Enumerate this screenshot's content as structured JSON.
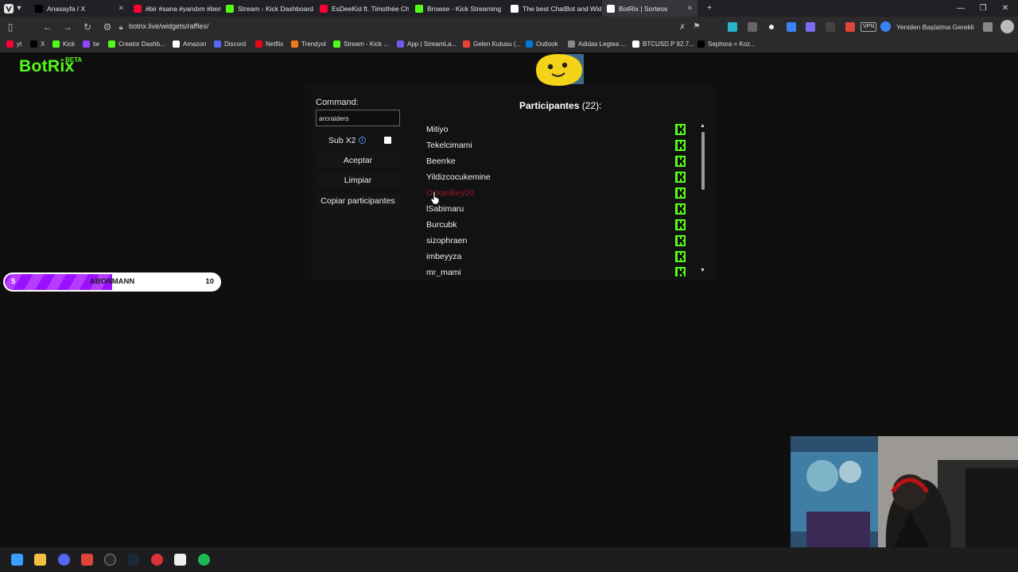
{
  "browser": {
    "tabs": [
      {
        "title": "Anasayfa / X",
        "color": "#000000"
      },
      {
        "title": "#bir #sana #yandım #ben #",
        "color": "#ff0033"
      },
      {
        "title": "Stream - Kick Dashboard",
        "color": "#53fc18"
      },
      {
        "title": "EsDeeKid ft. Timothée Chal",
        "color": "#ff0033"
      },
      {
        "title": "Browse - Kick Streaming",
        "color": "#53fc18"
      },
      {
        "title": "The best ChatBot and Widg",
        "color": "#ffffff"
      },
      {
        "title": "BotRix | Sorteos",
        "color": "#ffffff"
      }
    ],
    "url": "botrix.live/widgets/raffles/",
    "restart_label": "Yeniden Başlatma Gerekli",
    "vpn_label": "VPN",
    "bookmarks": [
      {
        "label": "yt",
        "color": "#ff0033"
      },
      {
        "label": "X",
        "color": "#000000"
      },
      {
        "label": "Kick",
        "color": "#53fc18"
      },
      {
        "label": "tw",
        "color": "#9146ff"
      },
      {
        "label": "Creator Dashb...",
        "color": "#53fc18"
      },
      {
        "label": "Amazon",
        "color": "#ffffff"
      },
      {
        "label": "Discord",
        "color": "#5865f2"
      },
      {
        "label": "Netflix",
        "color": "#e50914"
      },
      {
        "label": "Trendyol",
        "color": "#f27a1a"
      },
      {
        "label": "Stream - Kick ...",
        "color": "#53fc18"
      },
      {
        "label": "App | StreamLa...",
        "color": "#6c5ce7"
      },
      {
        "label": "Gelen Kutusu (...",
        "color": "#ea4335"
      },
      {
        "label": "Outlook",
        "color": "#0078d4"
      },
      {
        "label": "Adidas Legtea ...",
        "color": "#888888"
      },
      {
        "label": "BTCUSD.P 92.7...",
        "color": "#ffffff"
      },
      {
        "label": "Sephora = Koz...",
        "color": "#000000"
      }
    ]
  },
  "app": {
    "logo": "BotRix",
    "logo_badge": "BETA",
    "accent": "#53fc18"
  },
  "raffle": {
    "command_label": "Command:",
    "command_value": "arcraiders",
    "sub_label": "Sub X2",
    "sub_checked": false,
    "accept_label": "Aceptar",
    "clear_label": "Limpiar",
    "copy_label": "Copiar participantes",
    "participants_title": "Participantes",
    "participants_count": "(22):",
    "participants": [
      {
        "name": "Mitiyo",
        "highlight": false
      },
      {
        "name": "Tekelcimami",
        "highlight": false
      },
      {
        "name": "Beerrke",
        "highlight": false
      },
      {
        "name": "Yildizcocukemine",
        "highlight": false
      },
      {
        "name": "OzkanBey20",
        "highlight": true
      },
      {
        "name": "lSabimaru",
        "highlight": false
      },
      {
        "name": "Burcubk",
        "highlight": false
      },
      {
        "name": "sizophraen",
        "highlight": false
      },
      {
        "name": "imbeyyza",
        "highlight": false
      },
      {
        "name": "mr_mami",
        "highlight": false
      }
    ]
  },
  "sub_goal": {
    "start": "5",
    "label": "ABONMANN",
    "end": "10",
    "progress": 0.5
  }
}
